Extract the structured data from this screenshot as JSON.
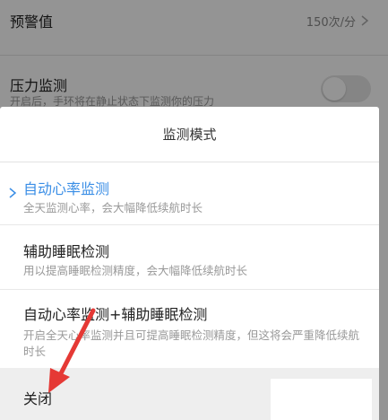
{
  "background": {
    "threshold_label": "预警值",
    "threshold_value": "150次/分",
    "pressure_label": "压力监测",
    "pressure_desc": "开启后，手环将在静止状态下监测你的压力",
    "pressure_toggle_on": false
  },
  "sheet": {
    "title": "监测模式",
    "options": [
      {
        "title": "自动心率监测",
        "desc": "全天监测心率，会大幅降低续航时长",
        "selected": true
      },
      {
        "title": "辅助睡眠检测",
        "desc": "用以提高睡眠检测精度，会大幅降低续航时长",
        "selected": false
      },
      {
        "title": "自动心率监测+辅助睡眠检测",
        "desc": "开启全天心率监测并且可提高睡眠检测精度，但这将会严重降低续航时长",
        "selected": false
      }
    ],
    "close_label": "关闭"
  },
  "colors": {
    "accent": "#3a8ee6",
    "annotation_arrow": "#e53935"
  }
}
